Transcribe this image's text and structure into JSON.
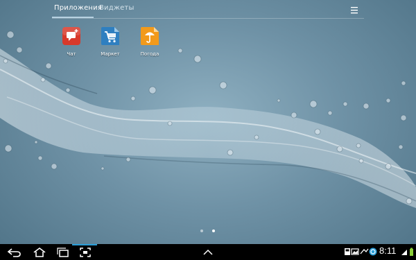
{
  "tabs": {
    "apps": "Приложения",
    "widgets": "Виджеты"
  },
  "apps": [
    {
      "label": "Чат",
      "icon": "chat-icon"
    },
    {
      "label": "Маркет",
      "icon": "market-icon"
    },
    {
      "label": "Погода",
      "icon": "weather-icon"
    }
  ],
  "pager": {
    "pages": 2,
    "current": 2
  },
  "status_bar": {
    "time": "8:11"
  },
  "colors": {
    "accent": "#2a9ed8",
    "chat": "#d8392b",
    "market": "#2f7fc0",
    "weather": "#f29a1b"
  }
}
